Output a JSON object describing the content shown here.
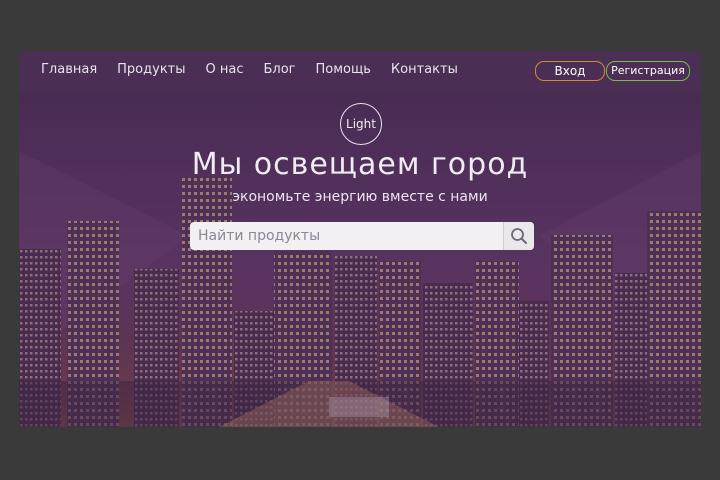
{
  "nav": {
    "items": [
      {
        "label": "Главная"
      },
      {
        "label": "Продукты"
      },
      {
        "label": "О нас"
      },
      {
        "label": "Блог"
      },
      {
        "label": "Помощь"
      },
      {
        "label": "Контакты"
      }
    ]
  },
  "auth": {
    "login_label": "Вход",
    "register_label": "Регистрация"
  },
  "hero": {
    "logo_text": "Light",
    "title": "Мы освещаем город",
    "subtitle": "экономьте энергию вместе с нами"
  },
  "search": {
    "placeholder": "Найти продукты",
    "icon": "search-icon"
  },
  "colors": {
    "login_border": "#d08a3a",
    "register_border": "#6fbf4a",
    "overlay": "#5a3561"
  }
}
